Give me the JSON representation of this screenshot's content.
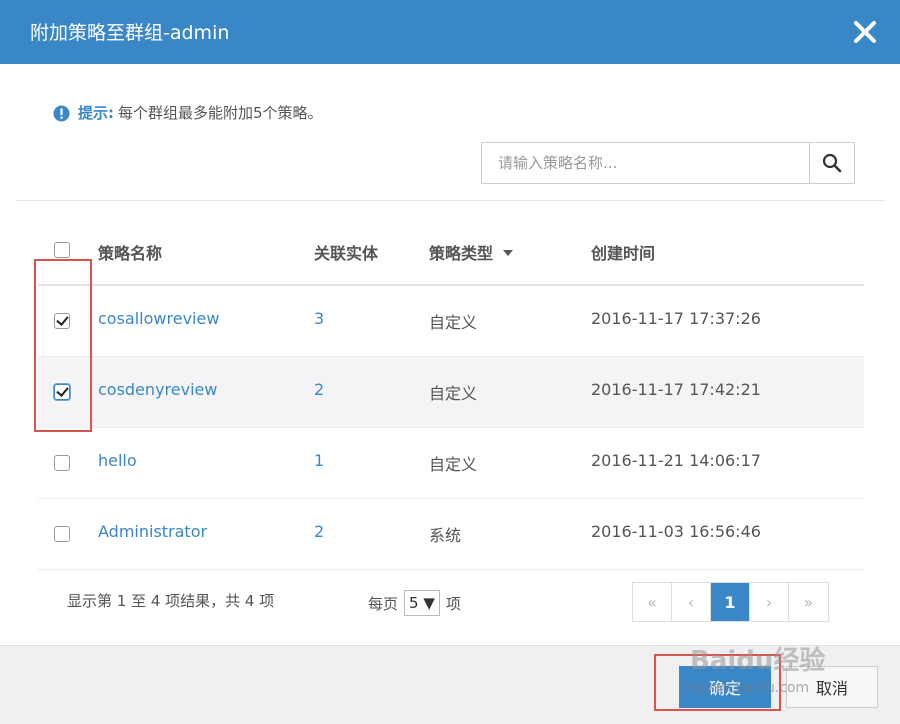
{
  "dialog": {
    "title": "附加策略至群组-admin",
    "close_icon": "close-icon"
  },
  "tip": {
    "icon": "info-icon",
    "label": "提示:",
    "text": "每个群组最多能附加5个策略。"
  },
  "search": {
    "placeholder": "请输入策略名称...",
    "value": "",
    "icon": "search-icon"
  },
  "table": {
    "columns": {
      "name": "策略名称",
      "entities": "关联实体",
      "type": "策略类型",
      "created": "创建时间"
    },
    "header_checked": false,
    "rows": [
      {
        "checked": true,
        "name": "cosallowreview",
        "entities": "3",
        "type": "自定义",
        "created": "2016-11-17 17:37:26"
      },
      {
        "checked": true,
        "name": "cosdenyreview",
        "entities": "2",
        "type": "自定义",
        "created": "2016-11-17 17:42:21"
      },
      {
        "checked": false,
        "name": "hello",
        "entities": "1",
        "type": "自定义",
        "created": "2016-11-21 14:06:17"
      },
      {
        "checked": false,
        "name": "Administrator",
        "entities": "2",
        "type": "系统",
        "created": "2016-11-03 16:56:46"
      }
    ]
  },
  "footer": {
    "info": "显示第 1 至 4 项结果，共 4 项",
    "page_size_prefix": "每页",
    "page_size_value": "5 ▼",
    "page_size_suffix": "项",
    "pager": {
      "first": "«",
      "prev": "‹",
      "current": "1",
      "next": "›",
      "last": "»"
    }
  },
  "buttons": {
    "ok": "确定",
    "cancel": "取消"
  },
  "watermark": {
    "main": "Baidu经验",
    "sub": "jingyan.baidu.com"
  },
  "colors": {
    "accent": "#3a87c8",
    "highlight": "#d9534f"
  }
}
